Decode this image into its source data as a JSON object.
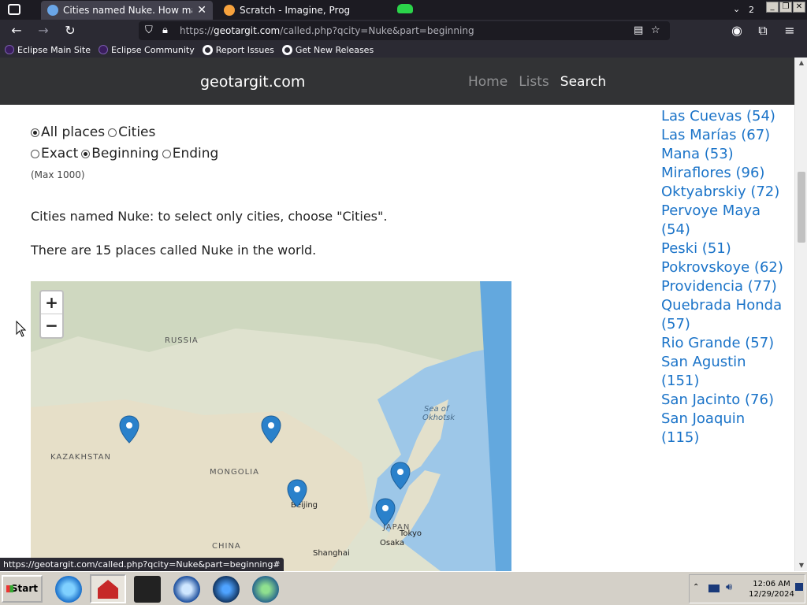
{
  "browser": {
    "tabs": [
      {
        "title": "Cities named Nuke. How many plac",
        "active": true
      },
      {
        "title": "Scratch - Imagine, Prog",
        "active": false
      }
    ],
    "tab_count": "2",
    "url_prefix": "https://",
    "url_host": "geotargit.com",
    "url_path": "/called.php?qcity=Nuke&part=beginning",
    "bookmarks": [
      "Eclipse Main Site",
      "Eclipse Community",
      "Report Issues",
      "Get New Releases"
    ],
    "status_url": "https://geotargit.com/called.php?qcity=Nuke&part=beginning#"
  },
  "site": {
    "brand": "geotargit.com",
    "nav": [
      "Home",
      "Lists",
      "Search"
    ],
    "nav_current": "Search"
  },
  "filters": {
    "scope": {
      "all_places": "All places",
      "cities": "Cities",
      "selected": "All places"
    },
    "match": {
      "exact": "Exact",
      "beginning": "Beginning",
      "ending": "Ending",
      "selected": "Beginning"
    },
    "max_note": "(Max 1000)"
  },
  "content": {
    "cities_note": "Cities named Nuke: to select only cities, choose \"Cities\".",
    "count_text": "There are 15 places called Nuke in the world."
  },
  "map": {
    "zoom_in": "+",
    "zoom_out": "−",
    "labels": [
      "RUSSIA",
      "KAZAKHSTAN",
      "MONGOLIA",
      "CHINA",
      "JAPAN"
    ],
    "sea_label": [
      "Sea of",
      "Okhotsk"
    ],
    "cities": [
      "Beijing",
      "Tokyo",
      "Osaka",
      "Shanghai"
    ],
    "marker_count": 5
  },
  "sidebar_list": [
    "Las Cuevas (54)",
    "Las Marías (67)",
    "Mana (53)",
    "Miraflores (96)",
    "Oktyabrskiy (72)",
    "Pervoye Maya (54)",
    "Peski (51)",
    "Pokrovskoye (62)",
    "Providencia (77)",
    "Quebrada Honda (57)",
    "Rio Grande (57)",
    "San Agustin (151)",
    "San Jacinto (76)",
    "San Joaquin (115)"
  ],
  "taskbar": {
    "start": "Start",
    "time": "12:06 AM",
    "date": "12/29/2024"
  },
  "colors": {
    "link": "#1a73c8",
    "header_bg": "#323335",
    "marker": "#2a81cb"
  }
}
